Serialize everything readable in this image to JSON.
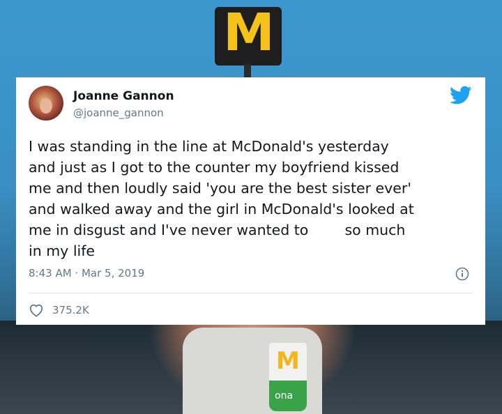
{
  "tweet": {
    "author_name": "Joanne Gannon",
    "author_handle": "@joanne_gannon",
    "text": "I was standing in the line at McDonald's yesterday\nand just as I got to the counter my boyfriend kissed\nme and then loudly said 'you are the best sister ever'\nand walked away and the girl in McDonald's looked at\nme in disgust and I've never wanted to        so much\nin my life",
    "time": "8:43 AM",
    "separator": " · ",
    "date": "Mar 5, 2019",
    "likes": "375.2K",
    "icons": [
      "twitter-bird-icon",
      "info-icon",
      "heart-icon"
    ],
    "colors": {
      "twitter_blue": "#1da1f2",
      "secondary_text": "#657786",
      "primary_text": "#14171a"
    }
  },
  "background": {
    "logo_text": "M",
    "cup_text": "ona"
  }
}
